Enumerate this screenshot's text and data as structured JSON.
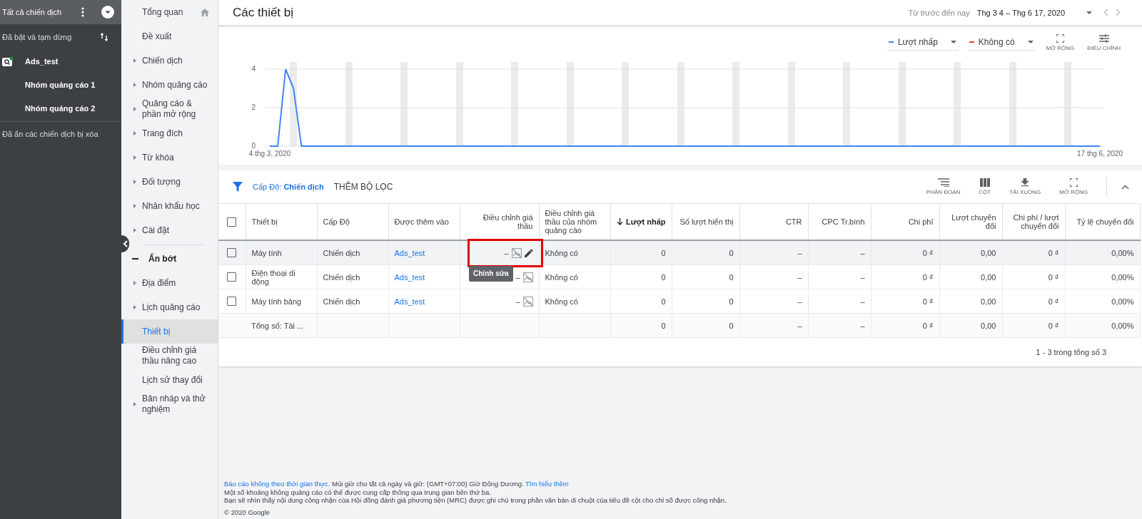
{
  "campaign_panel": {
    "title": "Tất cả chiến dịch",
    "section": "Đã bật và tạm dừng",
    "campaigns": [
      {
        "name": "Ads_test",
        "children": [
          {
            "name": "Nhóm quảng cáo 1"
          },
          {
            "name": "Nhóm quảng cáo 2"
          }
        ]
      }
    ],
    "hidden_note": "Đã ẩn các chiến dịch bị xóa"
  },
  "nav": {
    "items": [
      {
        "label": "Tổng quan",
        "kind": "home",
        "selected": false
      },
      {
        "label": "Đề xuất",
        "kind": "plain",
        "selected": false
      },
      {
        "label": "Chiến dịch",
        "kind": "expandable",
        "selected": false
      },
      {
        "label": "Nhóm quảng cáo",
        "kind": "expandable",
        "selected": false
      },
      {
        "label": "Quảng cáo & phần mở rộng",
        "kind": "expandable",
        "selected": false
      },
      {
        "label": "Trang đích",
        "kind": "expandable",
        "selected": false
      },
      {
        "label": "Từ khóa",
        "kind": "expandable",
        "selected": false
      },
      {
        "label": "Đối tượng",
        "kind": "expandable",
        "selected": false
      },
      {
        "label": "Nhân khẩu học",
        "kind": "expandable",
        "selected": false
      },
      {
        "label": "Cài đặt",
        "kind": "expandable",
        "selected": false
      },
      {
        "label": "Ẩn bớt",
        "kind": "toggle",
        "selected": false
      },
      {
        "label": "Địa điểm",
        "kind": "expandable",
        "selected": false
      },
      {
        "label": "Lịch quảng cáo",
        "kind": "expandable",
        "selected": false
      },
      {
        "label": "Thiết bị",
        "kind": "plain",
        "selected": true
      },
      {
        "label": "Điều chỉnh giá thầu nâng cao",
        "kind": "plain",
        "selected": false
      },
      {
        "label": "Lịch sử thay đổi",
        "kind": "plain",
        "selected": false
      },
      {
        "label": "Bản nháp và thử nghiệm",
        "kind": "expandable",
        "selected": false
      }
    ]
  },
  "page": {
    "title": "Các thiết bị",
    "date_label": "Từ trước đến nay",
    "date_range": "Thg 3 4 – Thg 6 17, 2020"
  },
  "chart_toolbar": {
    "comparison": {
      "label": "Không có",
      "color": "#db4437"
    },
    "actions": [
      {
        "label": "MỞ RỘNG",
        "kind": "expand"
      },
      {
        "label": "ĐIỀU CHỈNH",
        "kind": "adjust"
      }
    ]
  },
  "chart_data": {
    "type": "line",
    "ylim": [
      0,
      4
    ],
    "yticks": [
      0,
      2,
      4
    ],
    "categories": [
      "4 thg 3, 2020",
      null,
      null,
      null,
      null,
      null,
      null,
      null,
      null,
      null,
      null,
      null,
      null,
      null,
      null,
      null,
      null,
      null,
      null,
      null,
      null,
      null,
      null,
      null,
      null,
      null,
      null,
      null,
      null,
      null,
      null,
      null,
      null,
      null,
      null,
      null,
      null,
      null,
      null,
      null,
      null,
      null,
      null,
      null,
      null,
      null,
      null,
      null,
      null,
      null,
      null,
      null,
      null,
      null,
      null,
      null,
      null,
      null,
      null,
      null,
      null,
      null,
      null,
      null,
      null,
      null,
      null,
      null,
      null,
      null,
      null,
      null,
      null,
      null,
      null,
      null,
      null,
      null,
      null,
      null,
      null,
      null,
      null,
      null,
      null,
      null,
      null,
      null,
      null,
      null,
      null,
      null,
      null,
      null,
      null,
      null,
      null,
      null,
      null,
      null,
      null,
      null,
      null,
      null,
      null,
      "17 thg 6, 2020"
    ],
    "series": [
      {
        "name": "Lượt nhấp",
        "color": "#4285f4",
        "values": [
          0,
          0,
          4,
          3,
          0,
          0,
          0,
          0,
          0,
          0,
          0,
          0,
          0,
          0,
          0,
          0,
          0,
          0,
          0,
          0,
          0,
          0,
          0,
          0,
          0,
          0,
          0,
          0,
          0,
          0,
          0,
          0,
          0,
          0,
          0,
          0,
          0,
          0,
          0,
          0,
          0,
          0,
          0,
          0,
          0,
          0,
          0,
          0,
          0,
          0,
          0,
          0,
          0,
          0,
          0,
          0,
          0,
          0,
          0,
          0,
          0,
          0,
          0,
          0,
          0,
          0,
          0,
          0,
          0,
          0,
          0,
          0,
          0,
          0,
          0,
          0,
          0,
          0,
          0,
          0,
          0,
          0,
          0,
          0,
          0,
          0,
          0,
          0,
          0,
          0,
          0,
          0,
          0,
          0,
          0,
          0,
          0,
          0,
          0,
          0,
          0,
          0,
          0,
          0,
          0,
          0
        ]
      }
    ]
  },
  "table": {
    "all_checked": false,
    "filter": {
      "prefix": "Cấp Độ:",
      "value": "Chiến dịch"
    },
    "add_filter": "THÊM BỘ LỌC",
    "tools": [
      {
        "label": "PHÂN ĐOẠN",
        "kind": "segment"
      },
      {
        "label": "CỘT",
        "kind": "columns"
      },
      {
        "label": "TẢI XUỐNG",
        "kind": "download"
      },
      {
        "label": "MỞ RỘNG",
        "kind": "expand"
      }
    ],
    "columns": [
      {
        "label": "Thiết bị",
        "kind": "text",
        "sorted": false
      },
      {
        "label": "Cấp Độ",
        "kind": "text",
        "sorted": false
      },
      {
        "label": "Được thêm vào",
        "kind": "link",
        "sorted": false
      },
      {
        "label": "Điều chỉnh giá thầu",
        "kind": "bid",
        "sorted": false
      },
      {
        "label": "Điều chỉnh giá thầu của nhóm quảng cáo",
        "kind": "text",
        "sorted": false
      },
      {
        "label": "Lượt nhấp",
        "kind": "number",
        "sorted": true
      },
      {
        "label": "Số lượt hiển thị",
        "kind": "number",
        "sorted": false
      },
      {
        "label": "CTR",
        "kind": "number",
        "sorted": false
      },
      {
        "label": "CPC Tr.bình",
        "kind": "number",
        "sorted": false
      },
      {
        "label": "Chi phí",
        "kind": "number",
        "sorted": false
      },
      {
        "label": "Lượt chuyển đổi",
        "kind": "number",
        "sorted": false
      },
      {
        "label": "Chi phí / lượt chuyển đổi",
        "kind": "number",
        "sorted": false
      },
      {
        "label": "Tỷ lệ chuyển đổi",
        "kind": "number",
        "sorted": false
      }
    ],
    "rows": [
      {
        "checked": false,
        "highlighted": true,
        "cells": [
          "Máy tính",
          "Chiến dịch",
          "Ads_test",
          "–",
          "Không có",
          "0",
          "0",
          "–",
          "–",
          "0 ₫",
          "0,00",
          "0 ₫",
          "0,00%"
        ]
      },
      {
        "checked": false,
        "highlighted": false,
        "cells": [
          "Điện thoại di động",
          "Chiến dịch",
          "Ads_test",
          "–",
          "Không có",
          "0",
          "0",
          "–",
          "–",
          "0 ₫",
          "0,00",
          "0 ₫",
          "0,00%"
        ]
      },
      {
        "checked": false,
        "highlighted": false,
        "cells": [
          "Máy tính bảng",
          "Chiến dịch",
          "Ads_test",
          "–",
          "Không có",
          "0",
          "0",
          "–",
          "–",
          "0 ₫",
          "0,00",
          "0 ₫",
          "0,00%"
        ]
      }
    ],
    "total": {
      "label": "Tổng số: Tài ...",
      "cells": [
        "",
        "",
        "",
        "",
        "0",
        "0",
        "–",
        "–",
        "0 ₫",
        "0,00",
        "0 ₫",
        "0,00%"
      ]
    },
    "pagination": "1 - 3 trong tổng số 3",
    "tooltip": "Chỉnh sửa"
  },
  "footer": {
    "note_link": "Báo cáo không theo thời gian thực.",
    "note": "Múi giờ cho tất cả ngày và giờ: (GMT+07:00) Giờ Đông Dương.",
    "learn_more": "Tìm hiểu thêm",
    "lines": [
      "Một số khoảng không quảng cáo có thể được cung cấp thông qua trung gian bên thứ ba.",
      "Bạn sẽ nhìn thấy nội dung công nhận của Hội đồng đánh giá phương tiện (MRC) được ghi chú trong phần văn bản di chuột của tiêu đề cột cho chỉ số được công nhận."
    ],
    "copyright": "© 2020 Google"
  }
}
